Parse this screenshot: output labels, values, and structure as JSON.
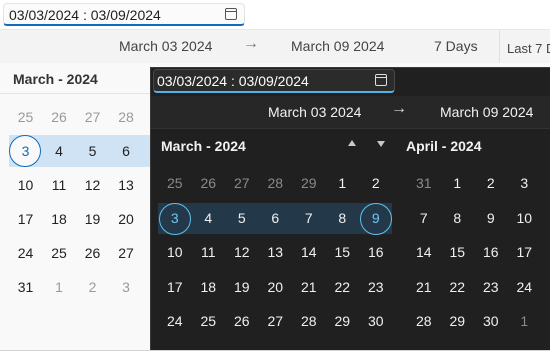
{
  "background_picker": {
    "input_value": "03/03/2024 : 03/09/2024",
    "header": {
      "start": "March 03 2024",
      "arrow": "→",
      "end": "March 09 2024",
      "duration": "7 Days",
      "preset": "Last 7 D"
    },
    "month_title": "March - 2024",
    "weeks": [
      [
        {
          "d": "25",
          "dim": true
        },
        {
          "d": "26",
          "dim": true
        },
        {
          "d": "27",
          "dim": true
        },
        {
          "d": "28",
          "dim": true
        }
      ],
      [
        {
          "d": "3",
          "sel": true
        },
        {
          "d": "4"
        },
        {
          "d": "5"
        },
        {
          "d": "6"
        }
      ],
      [
        {
          "d": "10"
        },
        {
          "d": "11"
        },
        {
          "d": "12"
        },
        {
          "d": "13"
        }
      ],
      [
        {
          "d": "17"
        },
        {
          "d": "18"
        },
        {
          "d": "19"
        },
        {
          "d": "20"
        }
      ],
      [
        {
          "d": "24"
        },
        {
          "d": "25"
        },
        {
          "d": "26"
        },
        {
          "d": "27"
        }
      ],
      [
        {
          "d": "31"
        },
        {
          "d": "1",
          "dim": true
        },
        {
          "d": "2",
          "dim": true
        },
        {
          "d": "3",
          "dim": true
        }
      ]
    ],
    "range_week_index": 1
  },
  "popup": {
    "input_value": "03/03/2024 : 03/09/2024",
    "header": {
      "start": "March 03 2024",
      "arrow": "→",
      "end": "March 09 2024"
    },
    "left_month": {
      "title": "March - 2024",
      "range_week_index": 1,
      "weeks": [
        [
          {
            "d": "25",
            "dim": true
          },
          {
            "d": "26",
            "dim": true
          },
          {
            "d": "27",
            "dim": true
          },
          {
            "d": "28",
            "dim": true
          },
          {
            "d": "29",
            "dim": true
          },
          {
            "d": "1"
          },
          {
            "d": "2"
          }
        ],
        [
          {
            "d": "3",
            "sel": true
          },
          {
            "d": "4"
          },
          {
            "d": "5"
          },
          {
            "d": "6"
          },
          {
            "d": "7"
          },
          {
            "d": "8"
          },
          {
            "d": "9",
            "sel": true
          }
        ],
        [
          {
            "d": "10"
          },
          {
            "d": "11"
          },
          {
            "d": "12"
          },
          {
            "d": "13"
          },
          {
            "d": "14"
          },
          {
            "d": "15"
          },
          {
            "d": "16"
          }
        ],
        [
          {
            "d": "17"
          },
          {
            "d": "18"
          },
          {
            "d": "19"
          },
          {
            "d": "20"
          },
          {
            "d": "21"
          },
          {
            "d": "22"
          },
          {
            "d": "23"
          }
        ],
        [
          {
            "d": "24"
          },
          {
            "d": "25"
          },
          {
            "d": "26"
          },
          {
            "d": "27"
          },
          {
            "d": "28"
          },
          {
            "d": "29"
          },
          {
            "d": "30"
          }
        ]
      ]
    },
    "right_month": {
      "title": "April - 2024",
      "weeks": [
        [
          {
            "d": "31",
            "dim": true
          },
          {
            "d": "1"
          },
          {
            "d": "2"
          },
          {
            "d": "3"
          },
          {
            "d": "4"
          }
        ],
        [
          {
            "d": "7"
          },
          {
            "d": "8"
          },
          {
            "d": "9"
          },
          {
            "d": "10"
          },
          {
            "d": "11"
          }
        ],
        [
          {
            "d": "14"
          },
          {
            "d": "15"
          },
          {
            "d": "16"
          },
          {
            "d": "17"
          },
          {
            "d": "18"
          }
        ],
        [
          {
            "d": "21"
          },
          {
            "d": "22"
          },
          {
            "d": "23"
          },
          {
            "d": "24"
          },
          {
            "d": "25"
          }
        ],
        [
          {
            "d": "28"
          },
          {
            "d": "29"
          },
          {
            "d": "30"
          },
          {
            "d": "1",
            "dim": true
          },
          {
            "d": "2",
            "dim": true
          }
        ]
      ]
    }
  },
  "colors": {
    "accent_light": "#0f6cbd",
    "accent_dark": "#60c0f0",
    "range_light": "#cfe3f5",
    "range_dark": "#23394a"
  },
  "icons": [
    "calendar-icon",
    "arrow-right-icon",
    "chevron-up-icon",
    "chevron-down-icon"
  ]
}
